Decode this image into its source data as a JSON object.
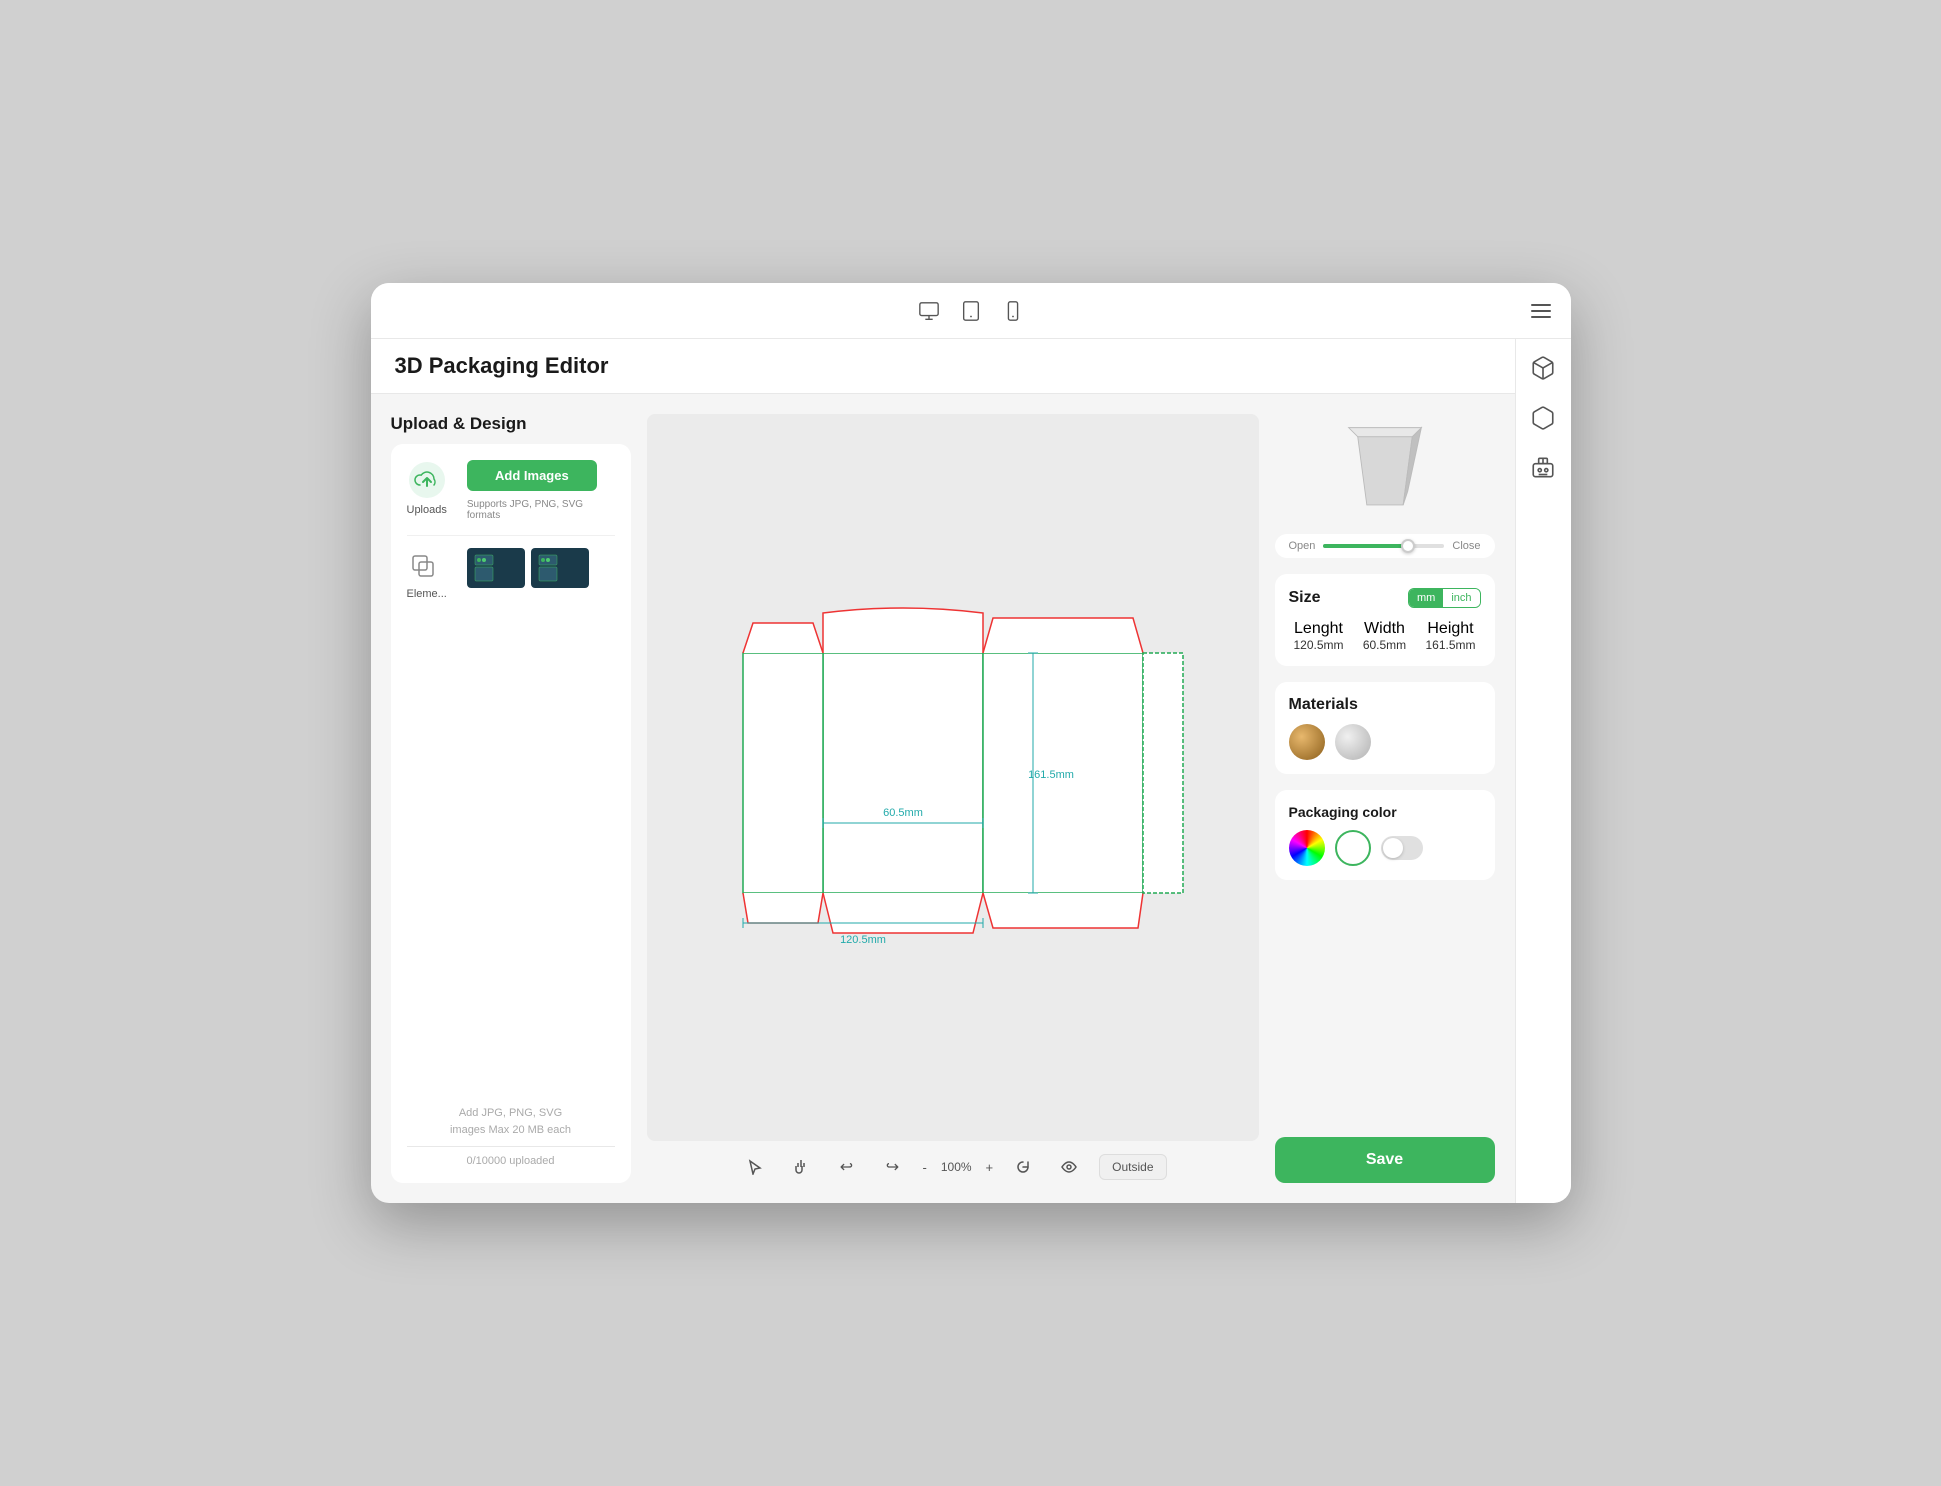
{
  "window": {
    "title": "3D Packaging Editor",
    "top_icons": [
      "desktop-icon",
      "tablet-icon",
      "mobile-icon"
    ],
    "hamburger_label": "menu"
  },
  "sidebar": {
    "icons": [
      "box-open-icon",
      "cube-icon",
      "robot-icon"
    ]
  },
  "header": {
    "title": "3D Packaging Editor",
    "section_title": "Upload & Design"
  },
  "left_panel": {
    "uploads_label": "Uploads",
    "elements_label": "Eleme...",
    "add_images_btn": "Add Images",
    "format_hint": "Supports JPG, PNG, SVG formats",
    "upload_hint_line1": "Add JPG, PNG, SVG",
    "upload_hint_line2": "images Max 20 MB each",
    "upload_count": "0/10000 uploaded"
  },
  "canvas": {
    "dimensions": {
      "width": "60.5mm",
      "height": "161.5mm",
      "length": "120.5mm"
    },
    "toolbar": {
      "zoom": "100%",
      "outside_btn": "Outside"
    }
  },
  "right_panel": {
    "slider": {
      "open_label": "Open",
      "close_label": "Close"
    },
    "size": {
      "label": "Size",
      "unit_mm": "mm",
      "unit_inch": "inch",
      "lenght_label": "Lenght",
      "width_label": "Width",
      "height_label": "Height",
      "lenght_value": "120.5mm",
      "width_value": "60.5mm",
      "height_value": "161.5mm"
    },
    "materials": {
      "label": "Materials"
    },
    "packaging_color": {
      "label": "Packaging color"
    },
    "save_btn": "Save"
  }
}
